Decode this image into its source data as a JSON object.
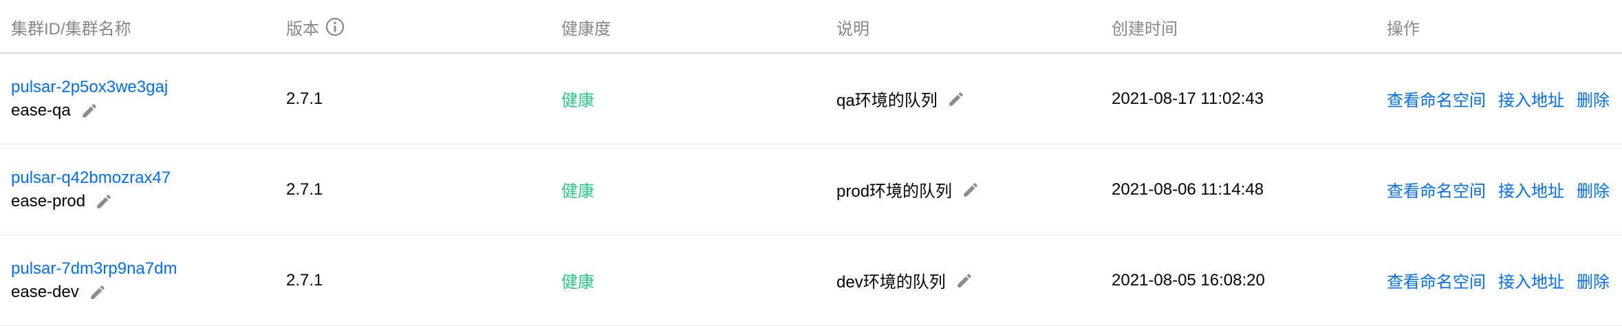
{
  "columns": {
    "id": "集群ID/集群名称",
    "version": "版本",
    "health": "健康度",
    "desc": "说明",
    "created": "创建时间",
    "ops": "操作"
  },
  "rows": [
    {
      "id": "pulsar-2p5ox3we3gaj",
      "name": "ease-qa",
      "version": "2.7.1",
      "health": "健康",
      "desc": "qa环境的队列",
      "created": "2021-08-17 11:02:43",
      "ops": [
        "查看命名空间",
        "接入地址",
        "删除"
      ]
    },
    {
      "id": "pulsar-q42bmozrax47",
      "name": "ease-prod",
      "version": "2.7.1",
      "health": "健康",
      "desc": "prod环境的队列",
      "created": "2021-08-06 11:14:48",
      "ops": [
        "查看命名空间",
        "接入地址",
        "删除"
      ]
    },
    {
      "id": "pulsar-7dm3rp9na7dm",
      "name": "ease-dev",
      "version": "2.7.1",
      "health": "健康",
      "desc": "dev环境的队列",
      "created": "2021-08-05 16:08:20",
      "ops": [
        "查看命名空间",
        "接入地址",
        "删除"
      ]
    }
  ],
  "colors": {
    "link": "#006eff",
    "health_ok": "#29cc85",
    "header_text": "#888888"
  },
  "icons": {
    "version_info": "info-icon",
    "edit": "pencil-edit-icon"
  }
}
